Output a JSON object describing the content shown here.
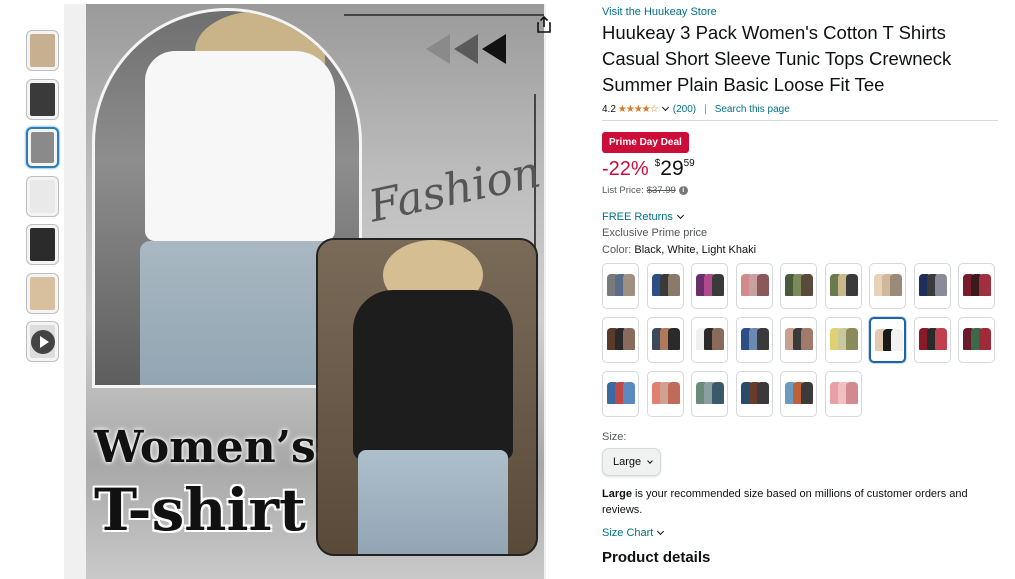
{
  "thumbnails": [
    {
      "name": "thumb-1",
      "color": "#c7b08f",
      "selected": false
    },
    {
      "name": "thumb-2",
      "color": "#3a3a3a",
      "selected": false
    },
    {
      "name": "thumb-3",
      "color": "#8a8a8a",
      "selected": true
    },
    {
      "name": "thumb-4",
      "color": "#e9e9e9",
      "selected": false
    },
    {
      "name": "thumb-5",
      "color": "#2b2b2b",
      "selected": false
    },
    {
      "name": "thumb-6",
      "color": "#d8bf9d",
      "selected": false
    },
    {
      "name": "thumb-video",
      "color": "#dddddd",
      "selected": false,
      "video": true
    }
  ],
  "poster": {
    "fashion_text": "Fashion",
    "womens_text": "Women’s",
    "tshirt_text": "T-shirt"
  },
  "product": {
    "store_link": "Visit the Huukeay Store",
    "title": "Huukeay 3 Pack Women's Cotton T Shirts Casual Short Sleeve Tunic Tops Crewneck Summer Plain Basic Loose Fit Tee",
    "rating": "4.2",
    "stars": "★★★★☆",
    "review_count": "(200)",
    "separator": "|",
    "search_page": "Search this page",
    "deal_badge": "Prime Day Deal",
    "discount": "-22%",
    "currency": "$",
    "price_whole": "29",
    "price_fraction": "59",
    "list_price_label": "List Price:",
    "list_price": "$37.99",
    "free_returns": "FREE Returns",
    "exclusive": "Exclusive Prime price",
    "color_label": "Color:",
    "color_value": "Black, White, Light Khaki",
    "size_label": "Size:",
    "size_value": "Large",
    "recommend_bold": "Large",
    "recommend_text": " is your recommended size based on millions of customer orders and reviews.",
    "size_chart": "Size Chart",
    "product_details": "Product details"
  },
  "swatches": [
    {
      "colors": [
        "#7a7a7a",
        "#5a6c8a",
        "#a09080"
      ],
      "selected": false
    },
    {
      "colors": [
        "#2c4f86",
        "#3a3a3a",
        "#8a7a6a"
      ],
      "selected": false
    },
    {
      "colors": [
        "#6a2f6a",
        "#b04a8a",
        "#3a3a3a"
      ],
      "selected": false
    },
    {
      "colors": [
        "#d28a8a",
        "#c8a0a0",
        "#8a5a5a"
      ],
      "selected": false
    },
    {
      "colors": [
        "#4a5a3a",
        "#7a8a5a",
        "#5a4a3a"
      ],
      "selected": false
    },
    {
      "colors": [
        "#6a7a4a",
        "#c8b88a",
        "#3a3a3a"
      ],
      "selected": false
    },
    {
      "colors": [
        "#e8d2b8",
        "#d0b89a",
        "#9a8a7a"
      ],
      "selected": false
    },
    {
      "colors": [
        "#1f2d5a",
        "#3a3a3a",
        "#8a8a9a"
      ],
      "selected": false
    },
    {
      "colors": [
        "#7a1a2a",
        "#3a1a1a",
        "#a03040"
      ],
      "selected": false
    },
    {
      "colors": [
        "#5a3a2a",
        "#2a2a2a",
        "#8a6a5a"
      ],
      "selected": false
    },
    {
      "colors": [
        "#3a4a5a",
        "#b07a5a",
        "#2a2a2a"
      ],
      "selected": false
    },
    {
      "colors": [
        "#f0f0f0",
        "#2a2a2a",
        "#8a6a5a"
      ],
      "selected": false
    },
    {
      "colors": [
        "#2c4f86",
        "#6a8ab0",
        "#3a3a3a"
      ],
      "selected": false
    },
    {
      "colors": [
        "#c8a090",
        "#3a3a3a",
        "#a07a6a"
      ],
      "selected": false
    },
    {
      "colors": [
        "#e0d070",
        "#c8c8a0",
        "#8a8a5a"
      ],
      "selected": false
    },
    {
      "colors": [
        "#e0cbb0",
        "#1a1a1a",
        "#f2f2f2"
      ],
      "selected": true
    },
    {
      "colors": [
        "#8a1a2a",
        "#2a2a2a",
        "#c04050"
      ],
      "selected": false
    },
    {
      "colors": [
        "#6a1a2a",
        "#3a6a4a",
        "#a02a3a"
      ],
      "selected": false
    },
    {
      "colors": [
        "#3a6aa0",
        "#c04a4a",
        "#5a8ac0"
      ],
      "selected": false
    },
    {
      "colors": [
        "#e08070",
        "#d0a090",
        "#c06a5a"
      ],
      "selected": false
    },
    {
      "colors": [
        "#6a8a7a",
        "#8aa0a0",
        "#3a5a6a"
      ],
      "selected": false
    },
    {
      "colors": [
        "#2a4a6a",
        "#6a3a2a",
        "#3a3a3a"
      ],
      "selected": false
    },
    {
      "colors": [
        "#6a9ac0",
        "#c0603a",
        "#3a3a3a"
      ],
      "selected": false
    },
    {
      "colors": [
        "#e8a0a8",
        "#f0c0c0",
        "#d08a90"
      ],
      "selected": false
    }
  ]
}
